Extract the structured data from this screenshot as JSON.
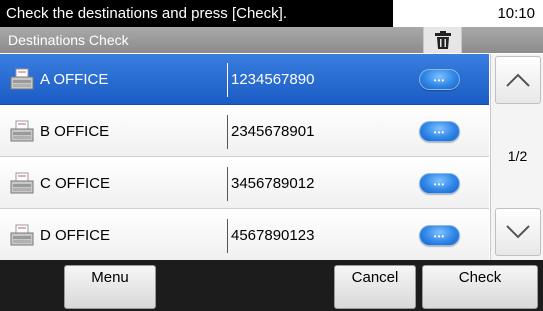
{
  "status": {
    "message": "Check the destinations and press [Check].",
    "time": "10:10"
  },
  "title": "Destinations Check",
  "icons": {
    "trash": "trash-icon",
    "destination": "fax-machine-icon",
    "detail": "detail-button-icon",
    "up": "chevron-up-icon",
    "down": "chevron-down-icon"
  },
  "destinations": [
    {
      "name": "A OFFICE",
      "number": "1234567890",
      "selected": true
    },
    {
      "name": "B OFFICE",
      "number": "2345678901",
      "selected": false
    },
    {
      "name": "C OFFICE",
      "number": "3456789012",
      "selected": false
    },
    {
      "name": "D OFFICE",
      "number": "4567890123",
      "selected": false
    }
  ],
  "pagination": {
    "page": "1/2"
  },
  "buttons": {
    "menu": "Menu",
    "cancel": "Cancel",
    "check": "Check"
  },
  "colors": {
    "selected_row": "#2a6ed6",
    "detail_button": "#2f86e8",
    "bottom_bar": "#1c1c1c"
  }
}
